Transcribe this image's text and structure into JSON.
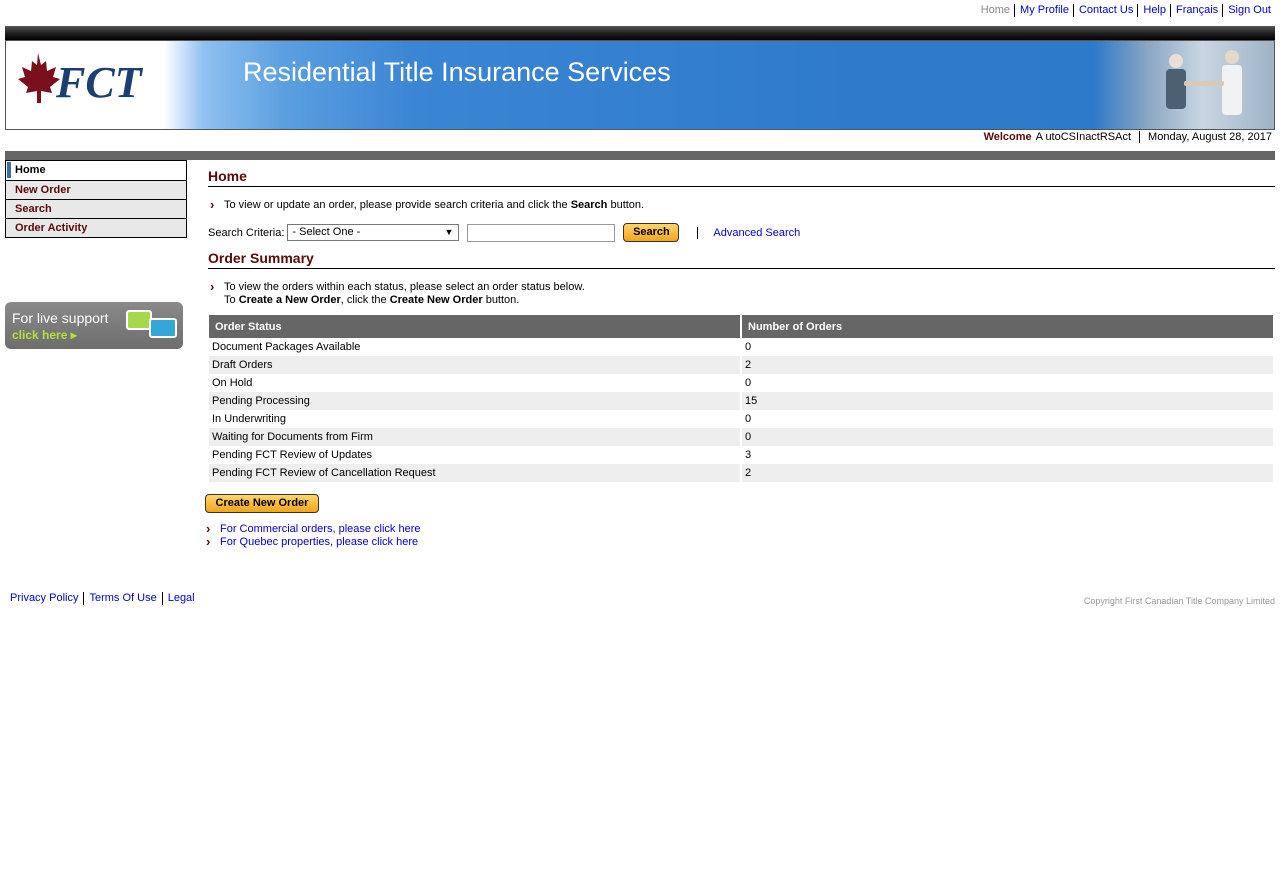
{
  "top_links": [
    "Home",
    "My Profile",
    "Contact Us",
    "Help",
    "Français",
    "Sign Out"
  ],
  "header": {
    "logo_text": "FCT",
    "title": "Residential Title Insurance Services"
  },
  "welcome": {
    "label": "Welcome",
    "user": "A utoCSInactRSAct",
    "date": "Monday, August 28, 2017"
  },
  "nav": [
    "Home",
    "New Order",
    "Search",
    "Order Activity"
  ],
  "live_support": {
    "line1": "For live support",
    "line2": "click here ▸"
  },
  "main": {
    "title": "Home",
    "search_instruction_pre": "To view or update an order, please provide search criteria and click the ",
    "search_instruction_bold": "Search",
    "search_instruction_post": " button.",
    "search_label": "Search Criteria:",
    "search_select_value": "- Select One -",
    "search_input_value": "",
    "search_button": "Search",
    "advanced_search": "Advanced Search",
    "summary_title": "Order Summary",
    "summary_line1": "To view the orders within each status, please select an order status below.",
    "summary_line2_a": "To ",
    "summary_line2_b": "Create a New Order",
    "summary_line2_c": ", click the ",
    "summary_line2_d": "Create New Order",
    "summary_line2_e": " button.",
    "table_headers": [
      "Order Status",
      "Number of Orders"
    ],
    "table_rows": [
      [
        "Document Packages Available",
        "0"
      ],
      [
        "Draft Orders",
        "2"
      ],
      [
        "On Hold",
        "0"
      ],
      [
        "Pending Processing",
        "15"
      ],
      [
        "In Underwriting",
        "0"
      ],
      [
        "Waiting for Documents from Firm",
        "0"
      ],
      [
        "Pending FCT Review of Updates",
        "3"
      ],
      [
        "Pending FCT Review of Cancellation Request",
        "2"
      ]
    ],
    "create_button": "Create New Order",
    "commercial_link": "For Commercial orders, please click here",
    "quebec_link": "For Quebec properties, please click here"
  },
  "footer": {
    "links": [
      "Privacy Policy",
      "Terms Of Use",
      "Legal"
    ],
    "copyright": "Copyright First Canadian Title Company Limited"
  }
}
